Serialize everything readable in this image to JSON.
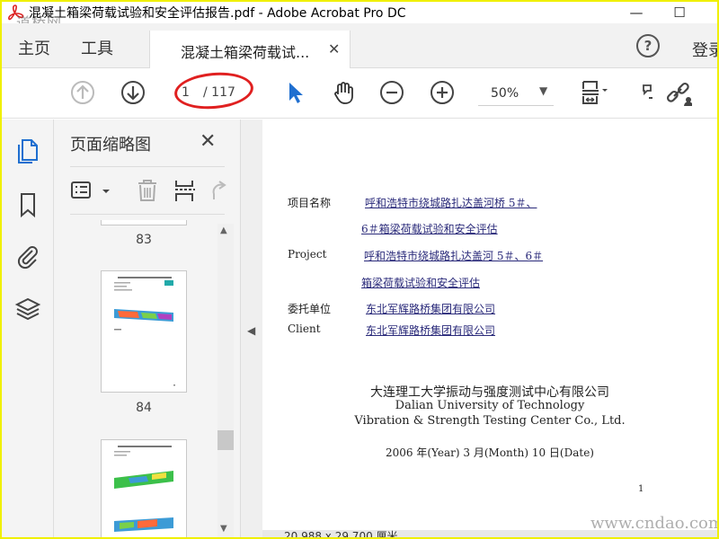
{
  "window": {
    "title": "混凝土箱梁荷载试验和安全评估报告.pdf - Adobe Acrobat Pro DC",
    "minimize": "—",
    "maximize": "☐",
    "watermark_tl": "道桥网"
  },
  "tabs": {
    "home": "主页",
    "tools": "工具",
    "document_tab": "混凝土箱梁荷载试...",
    "close": "✕",
    "help": "?",
    "sign_in": "登录"
  },
  "toolbar": {
    "page_current": "1",
    "page_total": "/ 117",
    "zoom": "50%",
    "zoom_caret": "▼",
    "icons": [
      "page-up-icon",
      "page-down-icon",
      "select-cursor-icon",
      "hand-icon",
      "zoom-out-icon",
      "zoom-in-icon",
      "fit-page-icon",
      "comment-icon",
      "share-link-icon"
    ]
  },
  "left_rail": {
    "icons": [
      "page-thumbnails-icon",
      "bookmark-icon",
      "attachment-icon",
      "layers-icon"
    ]
  },
  "thumbnail_panel": {
    "title": "页面缩略图",
    "close": "✕",
    "pages": [
      {
        "label": "83"
      },
      {
        "label": "84"
      }
    ]
  },
  "document": {
    "project_name_label": "项目名称",
    "project_name_line1": "呼和浩特市绕城路扎达盖河桥 5＃、",
    "project_name_line2": "6＃箱梁荷载试验和安全评估",
    "project_label": "Project",
    "project_line1": "呼和浩特市绕城路扎达盖河 5＃、6＃",
    "project_line2": "箱梁荷载试验和安全评估",
    "client_cn_label": "委托单位",
    "client_cn": "东北军辉路桥集团有限公司",
    "client_label": "Client",
    "client_value": "东北军辉路桥集团有限公司",
    "org_cn": "大连理工大学振动与强度测试中心有限公司",
    "org_en1": "Dalian University of Technology",
    "org_en2": "Vibration & Strength Testing Center Co., Ltd.",
    "date": "2006 年(Year) 3 月(Month) 10 日(Date)",
    "page_number": "1"
  },
  "status": {
    "dimensions": "20.988 x 29.700 厘米"
  },
  "watermark_br": "www.cndao.com",
  "colors": {
    "accent_blue": "#1f6fd0",
    "annotation_red": "#e02020",
    "frame_yellow": "#f0f000"
  }
}
